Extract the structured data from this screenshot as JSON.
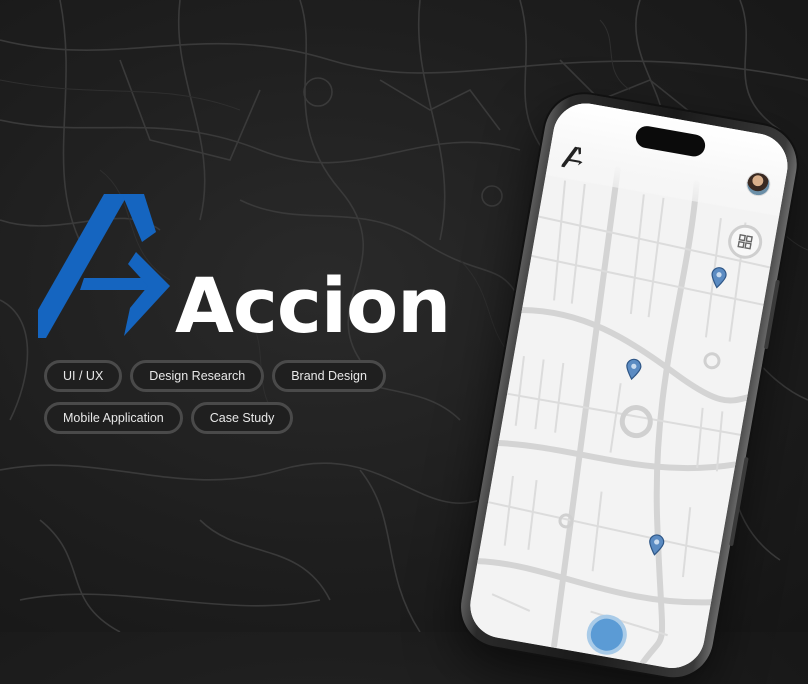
{
  "brand": {
    "name": "Accion",
    "accent_color": "#1565c0",
    "logo_icon": "accion-logo-icon"
  },
  "tags": {
    "row1": [
      "UI / UX",
      "Design Research",
      "Brand Design"
    ],
    "row2": [
      "Mobile Application",
      "Case Study"
    ]
  },
  "phone": {
    "header": {
      "logo_icon": "accion-logo-icon",
      "avatar_icon": "user-avatar",
      "layers_icon": "map-layers-icon"
    },
    "pins": [
      "map-pin-icon",
      "map-pin-icon",
      "map-pin-icon"
    ],
    "pin_color": "#5b8bc2"
  }
}
